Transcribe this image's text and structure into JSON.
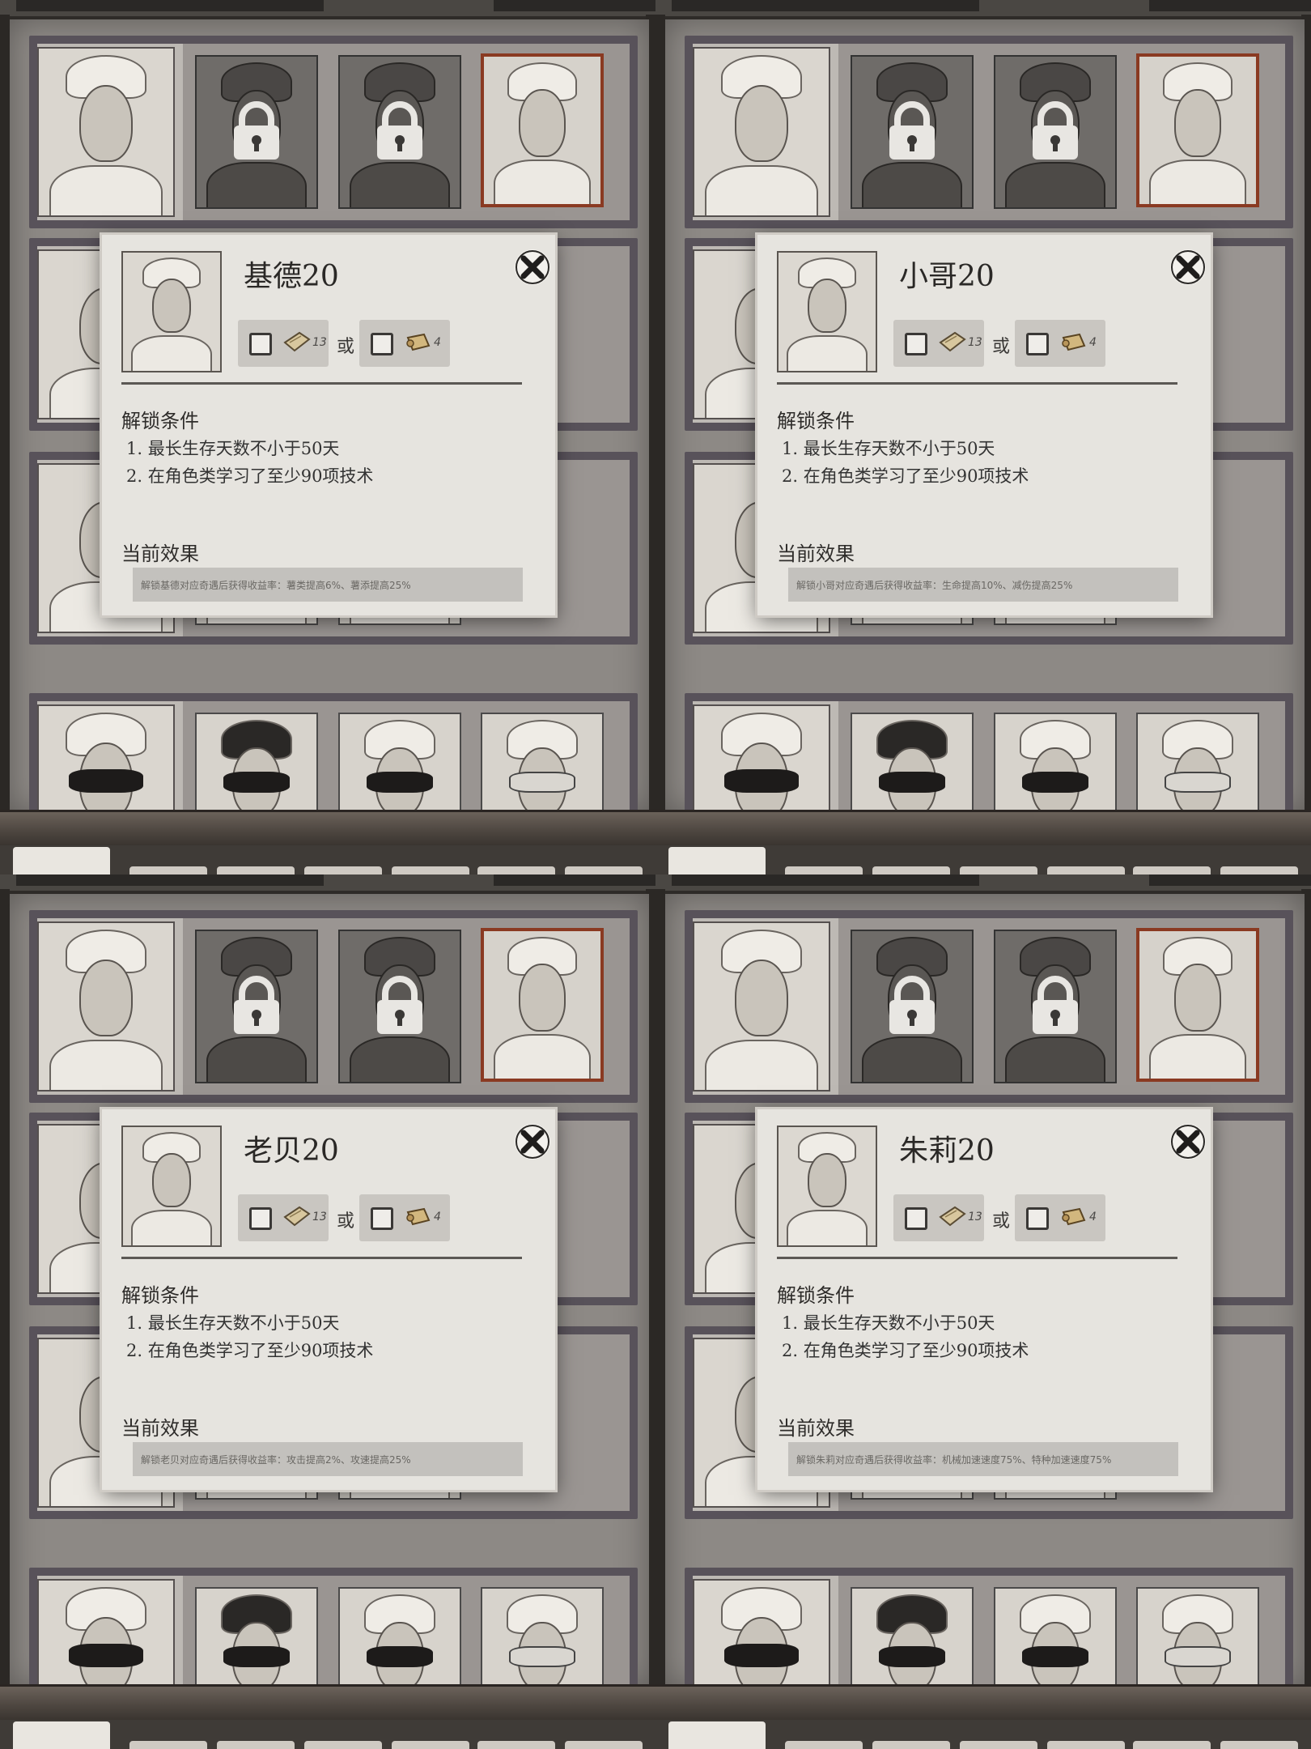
{
  "panels": [
    {
      "character_name": "基德20",
      "cost_a_count": "13",
      "or_label": "或",
      "cost_b_count": "4",
      "unlock_title": "解锁条件",
      "conditions": [
        "1. 最长生存天数不小于50天",
        "2. 在角色类学习了至少90项技术"
      ],
      "effect_title": "当前效果",
      "effect_text": "解锁基德对应奇遇后获得收益率：薯类提高6%、薯添提高25%"
    },
    {
      "character_name": "小哥20",
      "cost_a_count": "13",
      "or_label": "或",
      "cost_b_count": "4",
      "unlock_title": "解锁条件",
      "conditions": [
        "1. 最长生存天数不小于50天",
        "2. 在角色类学习了至少90项技术"
      ],
      "effect_title": "当前效果",
      "effect_text": "解锁小哥对应奇遇后获得收益率：生命提高10%、减伤提高25%"
    },
    {
      "character_name": "老贝20",
      "cost_a_count": "13",
      "or_label": "或",
      "cost_b_count": "4",
      "unlock_title": "解锁条件",
      "conditions": [
        "1. 最长生存天数不小于50天",
        "2. 在角色类学习了至少90项技术"
      ],
      "effect_title": "当前效果",
      "effect_text": "解锁老贝对应奇遇后获得收益率：攻击提高2%、攻速提高25%"
    },
    {
      "character_name": "朱莉20",
      "cost_a_count": "13",
      "or_label": "或",
      "cost_b_count": "4",
      "unlock_title": "解锁条件",
      "conditions": [
        "1. 最长生存天数不小于50天",
        "2. 在角色类学习了至少90项技术"
      ],
      "effect_title": "当前效果",
      "effect_text": "解锁朱莉对应奇遇后获得收益率：机械加速速度75%、特种加速速度75%"
    }
  ],
  "icons": {
    "lock": "lock-icon",
    "close": "close-icon",
    "checkbox": "checkbox-icon",
    "material_a": "plank-icon",
    "material_b": "scroll-icon"
  },
  "colors": {
    "parchment": "#e6e4df",
    "board": "#8d8985",
    "selected_border": "#8a3a22"
  }
}
